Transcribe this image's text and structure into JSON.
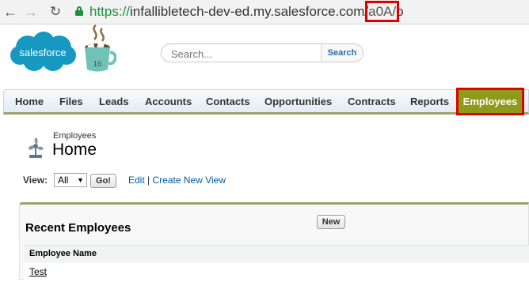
{
  "browser": {
    "url_scheme": "https://",
    "url_host": "infallibletech-dev-ed.my.salesforce.com/",
    "url_highlight": "a0A/",
    "url_tail": "o"
  },
  "header": {
    "logo_text": "salesforce",
    "mug_number": "16",
    "search_placeholder": "Search...",
    "search_button": "Search"
  },
  "tabs": [
    {
      "label": "Home"
    },
    {
      "label": "Files"
    },
    {
      "label": "Leads"
    },
    {
      "label": "Accounts"
    },
    {
      "label": "Contacts"
    },
    {
      "label": "Opportunities"
    },
    {
      "label": "Contracts"
    },
    {
      "label": "Reports"
    },
    {
      "label": "Employees",
      "active": true
    }
  ],
  "page": {
    "object_label": "Employees",
    "title": "Home"
  },
  "view": {
    "label": "View:",
    "selected": "All",
    "go_button": "Go!",
    "edit_link": "Edit",
    "separator": "|",
    "create_link": "Create New View"
  },
  "recent": {
    "title": "Recent Employees",
    "new_button": "New",
    "column_header": "Employee Name",
    "rows": [
      {
        "name": "Test"
      }
    ]
  },
  "colors": {
    "active_tab": "#8e9a1a",
    "highlight": "#e00000",
    "link": "#015ba7",
    "secure_green": "#1e8e3e"
  }
}
